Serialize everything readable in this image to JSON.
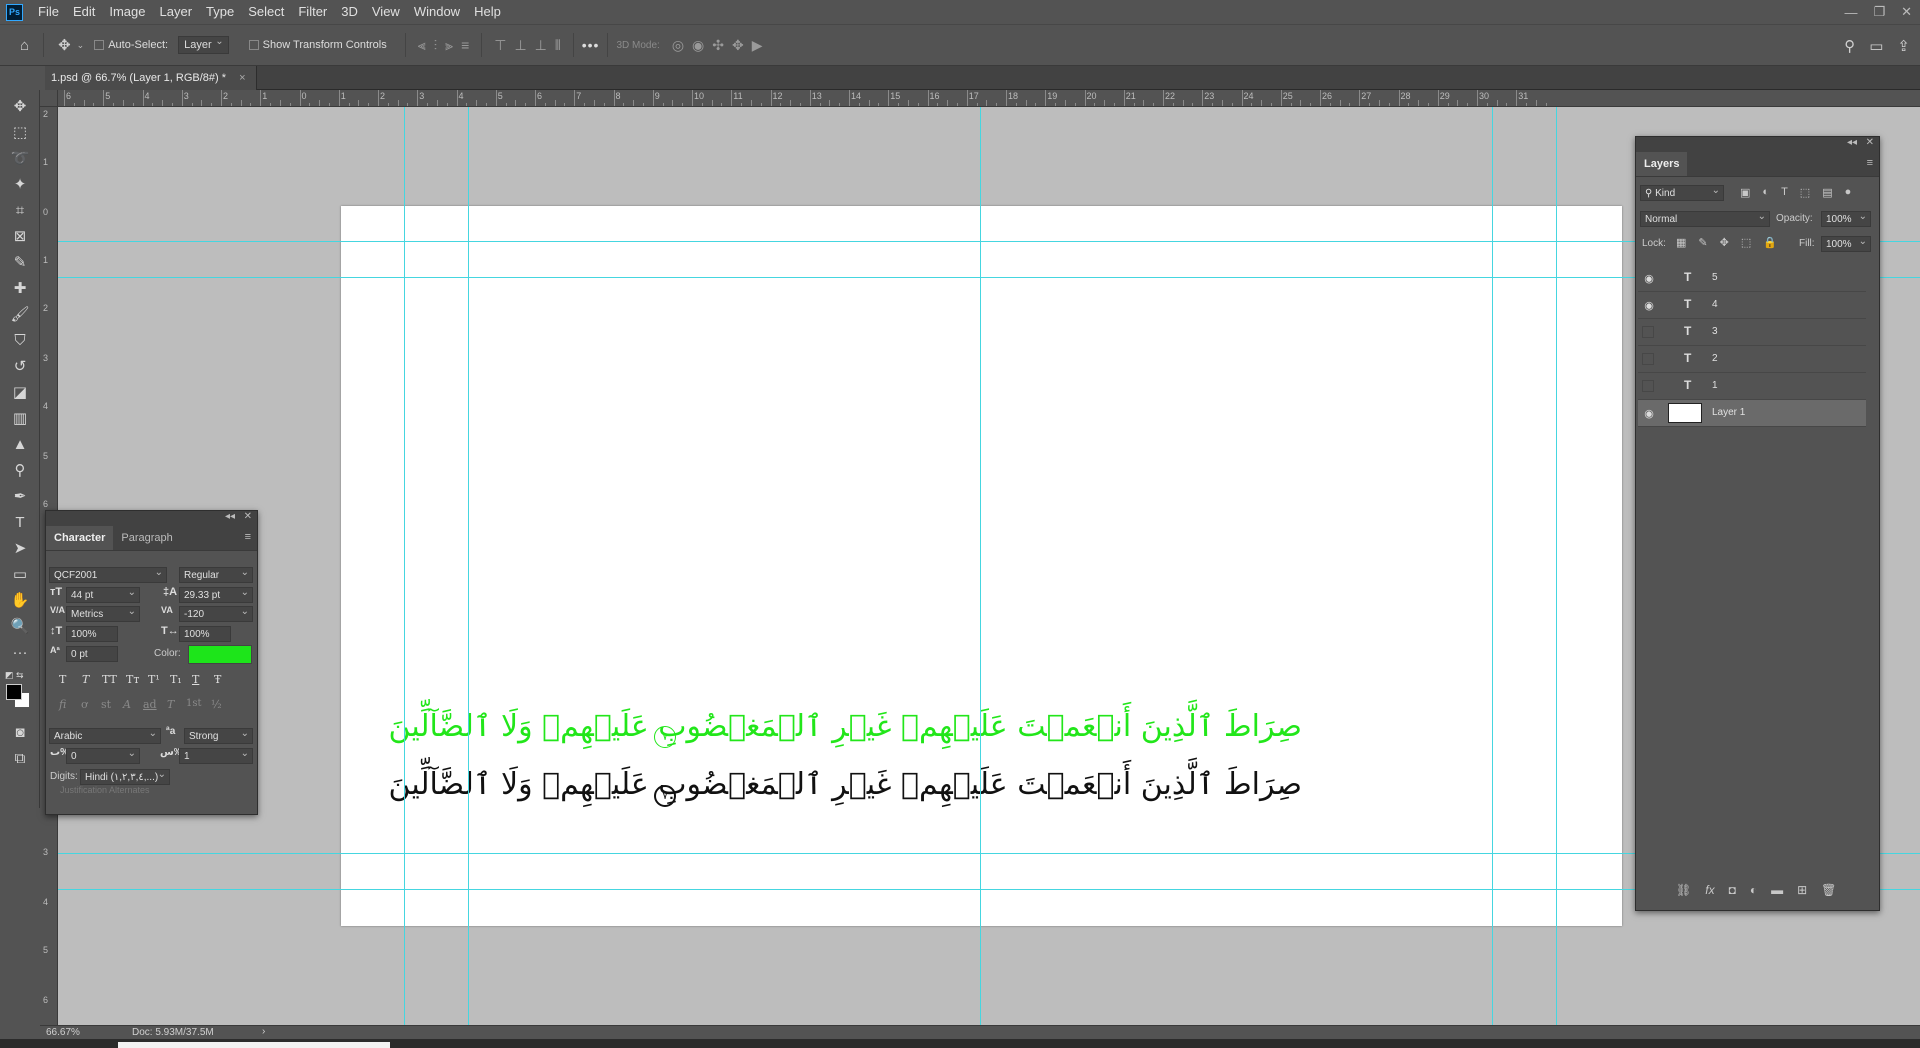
{
  "app": {
    "logo": "Ps"
  },
  "menu": [
    "File",
    "Edit",
    "Image",
    "Layer",
    "Type",
    "Select",
    "Filter",
    "3D",
    "View",
    "Window",
    "Help"
  ],
  "window_controls": [
    "—",
    "❐",
    "✕"
  ],
  "options_bar": {
    "auto_select_label": "Auto-Select:",
    "auto_select_value": "Layer",
    "show_transform_label": "Show Transform Controls",
    "more": "•••",
    "mode_3d": "3D Mode:"
  },
  "document_tab": {
    "title": "1.psd @ 66.7% (Layer 1, RGB/8#) *",
    "close": "×"
  },
  "ruler_top_labels": [
    "6",
    "5",
    "4",
    "3",
    "2",
    "1",
    "0",
    "1",
    "2",
    "3",
    "4",
    "5",
    "6",
    "7",
    "8",
    "9",
    "10",
    "11",
    "12",
    "13",
    "14",
    "15",
    "16",
    "17",
    "18",
    "19",
    "20",
    "21",
    "22",
    "23",
    "24",
    "25",
    "26",
    "27",
    "28",
    "29",
    "30",
    "31"
  ],
  "ruler_left_labels": [
    "2",
    "1",
    "0",
    "1",
    "2",
    "3",
    "4",
    "5",
    "6",
    "3",
    "4",
    "5",
    "6"
  ],
  "canvas_text": {
    "line_green": "صِرَاطَ ٱلَّذِينَ أَنۡعَمۡتَ عَلَيۡهِمۡ غَيۡرِ ٱلۡمَغۡضُوبِ عَلَيۡهِمۡ وَلَا ٱلضَّآلِّينَ",
    "line_black": "صِرَاطَ ٱلَّذِينَ أَنۡعَمۡتَ عَلَيۡهِمۡ غَيۡرِ ٱلۡمَغۡضُوبِ عَلَيۡهِمۡ وَلَا ٱلضَّآلِّينَ",
    "ayah_number": "٧",
    "green_color": "#22e61a",
    "black_color": "#111111"
  },
  "character_panel": {
    "tabs": [
      "Character",
      "Paragraph"
    ],
    "font_family": "QCF2001",
    "font_style": "Regular",
    "font_size": "44 pt",
    "leading": "29.33 pt",
    "kerning": "Metrics",
    "tracking": "-120",
    "vertical_scale": "100%",
    "horizontal_scale": "100%",
    "baseline_shift": "0 pt",
    "color_label": "Color:",
    "color_value": "#1de51a",
    "type_buttons": [
      "T",
      "T",
      "TT",
      "Tт",
      "T¹",
      "T₁",
      "T",
      "Ŧ"
    ],
    "opentype_buttons": [
      "fi",
      "ơ",
      "st",
      "A",
      "ad",
      "T",
      "1st",
      "½"
    ],
    "language": "Arabic",
    "antialias_icon": "ªa",
    "antialias": "Strong",
    "kashida_value": "0",
    "diacritic_value": "1",
    "digits_label": "Digits:",
    "digits_value": "Hindi (١,٢,٣,٤,...)",
    "justification_label": "Justification Alternates"
  },
  "layers_panel": {
    "title": "Layers",
    "filter_kind": "Kind",
    "blend_mode": "Normal",
    "opacity_label": "Opacity:",
    "opacity_value": "100%",
    "lock_label": "Lock:",
    "fill_label": "Fill:",
    "fill_value": "100%",
    "layers": [
      {
        "name": "5",
        "visible": true,
        "type": "text"
      },
      {
        "name": "4",
        "visible": true,
        "type": "text"
      },
      {
        "name": "3",
        "visible": false,
        "type": "text"
      },
      {
        "name": "2",
        "visible": false,
        "type": "text"
      },
      {
        "name": "1",
        "visible": false,
        "type": "text"
      },
      {
        "name": "Layer 1",
        "visible": true,
        "type": "pixel",
        "selected": true
      }
    ],
    "bottom_icons": [
      "link-icon",
      "fx-icon",
      "mask-icon",
      "adjustment-icon",
      "folder-icon",
      "new-layer-icon",
      "trash-icon"
    ]
  },
  "status_bar": {
    "zoom": "66.67%",
    "doc": "Doc: 5.93M/37.5M",
    "arrow": "›"
  }
}
